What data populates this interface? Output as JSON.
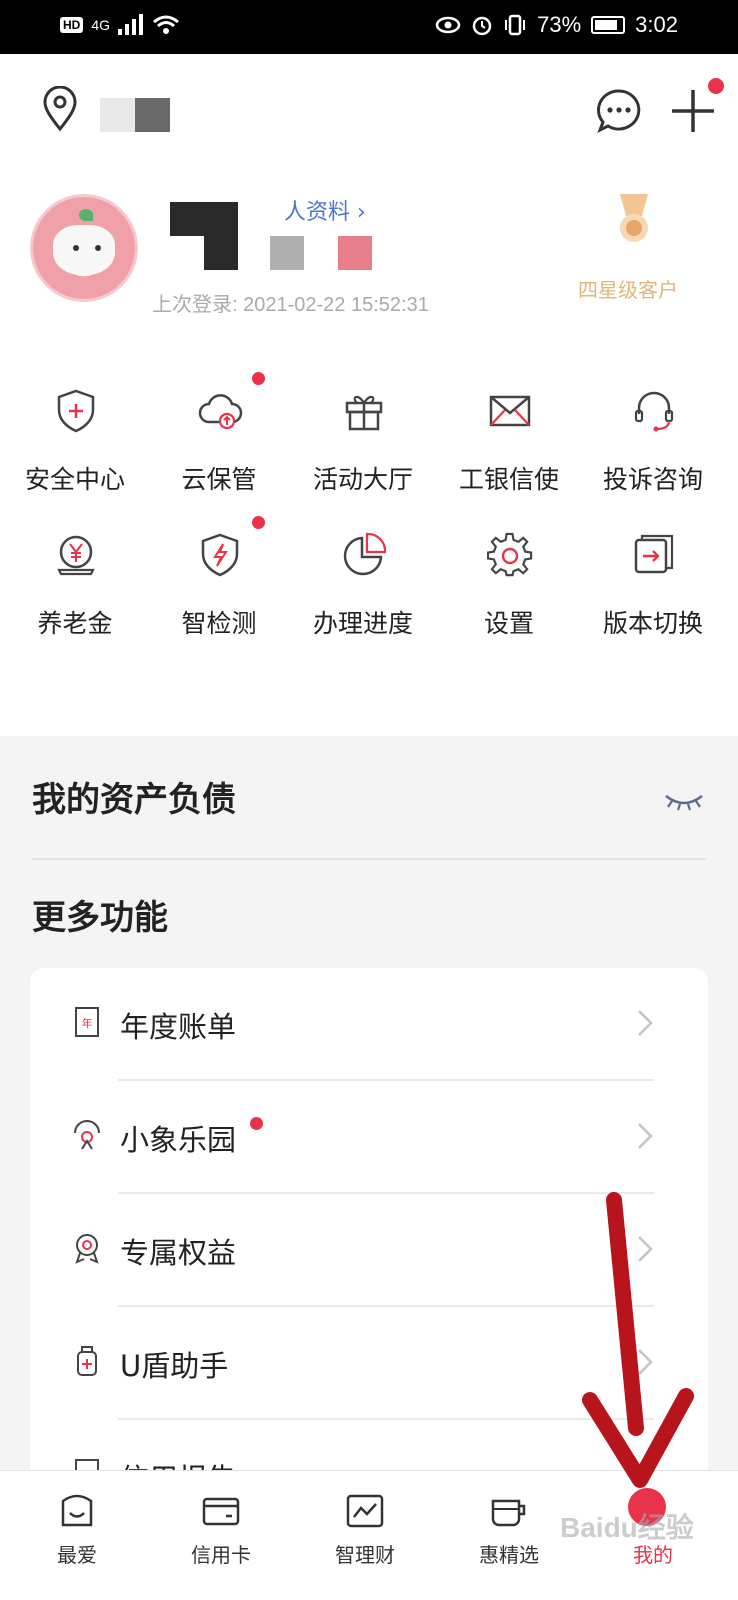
{
  "status_bar": {
    "network": "4G",
    "hd": "HD",
    "battery": "73%",
    "time": "3:02"
  },
  "profile": {
    "edit_link": "人资料 ›",
    "last_login": "上次登录: 2021-02-22 15:52:31",
    "vip_level": "四星级客户"
  },
  "quick_actions": [
    {
      "label": "安全中心",
      "icon": "shield-plus-icon",
      "dot": false
    },
    {
      "label": "云保管",
      "icon": "cloud-upload-icon",
      "dot": true
    },
    {
      "label": "活动大厅",
      "icon": "gift-icon",
      "dot": false
    },
    {
      "label": "工银信使",
      "icon": "envelope-icon",
      "dot": false
    },
    {
      "label": "投诉咨询",
      "icon": "headset-icon",
      "dot": false
    },
    {
      "label": "养老金",
      "icon": "yen-coin-icon",
      "dot": false
    },
    {
      "label": "智检测",
      "icon": "shield-bolt-icon",
      "dot": true
    },
    {
      "label": "办理进度",
      "icon": "pie-chart-icon",
      "dot": false
    },
    {
      "label": "设置",
      "icon": "gear-icon",
      "dot": false
    },
    {
      "label": "版本切换",
      "icon": "switch-icon",
      "dot": false
    }
  ],
  "assets_title": "我的资产负债",
  "more_title": "更多功能",
  "more_items": [
    {
      "label": "年度账单",
      "icon": "annual-bill-icon",
      "dot": false
    },
    {
      "label": "小象乐园",
      "icon": "elephant-park-icon",
      "dot": true
    },
    {
      "label": "专属权益",
      "icon": "badge-icon",
      "dot": false
    },
    {
      "label": "U盾助手",
      "icon": "ukey-icon",
      "dot": false
    },
    {
      "label": "信用报告",
      "icon": "credit-report-icon",
      "dot": false
    }
  ],
  "tabs": [
    {
      "label": "最爱",
      "icon": "favorite-icon"
    },
    {
      "label": "信用卡",
      "icon": "credit-card-icon"
    },
    {
      "label": "智理财",
      "icon": "wealth-chart-icon"
    },
    {
      "label": "惠精选",
      "icon": "coffee-cup-icon"
    },
    {
      "label": "我的",
      "icon": "me-icon",
      "active": true
    }
  ],
  "colors": {
    "accent_red": "#e8334a",
    "link_blue": "#4a78c9",
    "vip_gold": "#e0b77a",
    "arrow_red": "#b8141c"
  },
  "watermark": "Baidu经验"
}
